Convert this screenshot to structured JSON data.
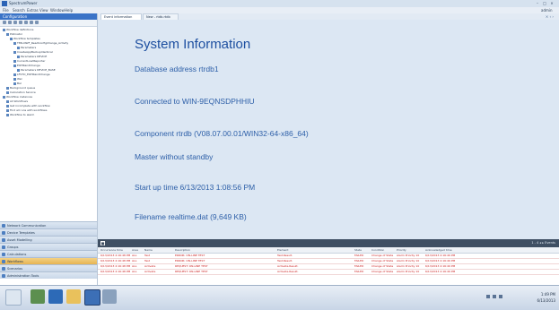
{
  "window": {
    "title": "SpectrumPower",
    "minimize": "–",
    "maximize": "□",
    "close": "×"
  },
  "menubar": {
    "items": [
      "File",
      "Search",
      "Extras",
      "View",
      "Window",
      "Help"
    ]
  },
  "user_badge": "admin",
  "left_panel": {
    "header": "Configuration",
    "tree": [
      "Workflow definitions",
      "Pollinator",
      "Workflow templates",
      "TMS-NWF_ReadConfigChange_Activity",
      "Parameters",
      "CreateAppBackupIdentical",
      "Parameters  DEVICE",
      "CurrentLoadReporter",
      "EOHRandChange",
      "Parameters  DEVICE_BASE",
      "LFSTO_EOHRandChange",
      "Wel",
      "Bal",
      "Background queue",
      "Calculation Service",
      "Workflow instances",
      "All Workflows",
      "Get incomplete with workflow",
      "Find all runs with workflows",
      "Workflow to alarm"
    ],
    "nav_sections": [
      "Network Communication",
      "Device Templates",
      "Asset Modelling",
      "Groups",
      "Calculations",
      "Workflows",
      "Scenarios",
      "Administration Tools"
    ],
    "active_section": "Workflows"
  },
  "tabs": [
    {
      "label": "Event information"
    },
    {
      "label": "New - rtdb.rtdb"
    }
  ],
  "tab_close": "× ‹ ›",
  "main": {
    "title": "System Information",
    "lines": [
      "Database address rtrdb1",
      "Connected to WIN-9EQNSDPHHIU",
      "Component rtrdb (V08.07.00.01/WIN32-64-x86_64)",
      "Master without standby",
      "Start up time 6/13/2013 1:08:56 PM",
      "Filename realtime.dat (9,649 KB)"
    ]
  },
  "events": {
    "collapse": "■",
    "controls": "1 - 4  ◂  ▸  Events",
    "columns": [
      "Occurrence time",
      "Area",
      "Name",
      "Description",
      "Element",
      "State",
      "Condition",
      "Priority",
      "Acknowledged time"
    ],
    "rows": [
      [
        "6/13/2013 2:16:48 PM",
        "ALL",
        "Test",
        "ERROR: ON-LINE TEST",
        "Test.Result.",
        "FAILED",
        "Change of State",
        "Alarm Priority 10",
        "6/13/2013 2:16:49 PM"
      ],
      [
        "6/13/2013 2:16:48 PM",
        "ALL",
        "Test",
        "ERROR: ON-LINE TEST",
        "Test.Result.",
        "FAILED",
        "Change of State",
        "Alarm Priority 10",
        "6/13/2013 2:16:49 PM"
      ],
      [
        "6/13/2013 2:16:48 PM",
        "ALL",
        "Activate",
        "REQUEST: ON-LINE TEST",
        "Activate.Result.",
        "FAILED",
        "Change of State",
        "Alarm Priority 10",
        "6/13/2013 2:16:49 PM"
      ],
      [
        "6/13/2013 2:16:48 PM",
        "ALL",
        "Activate",
        "REQUEST: ON-LINE TEST",
        "Activate.Result.",
        "FAILED",
        "Change of State",
        "Alarm Priority 10",
        "6/13/2013 2:16:49 PM"
      ]
    ]
  },
  "taskbar": {
    "time": "1:49 PM",
    "date": "6/13/2013"
  }
}
